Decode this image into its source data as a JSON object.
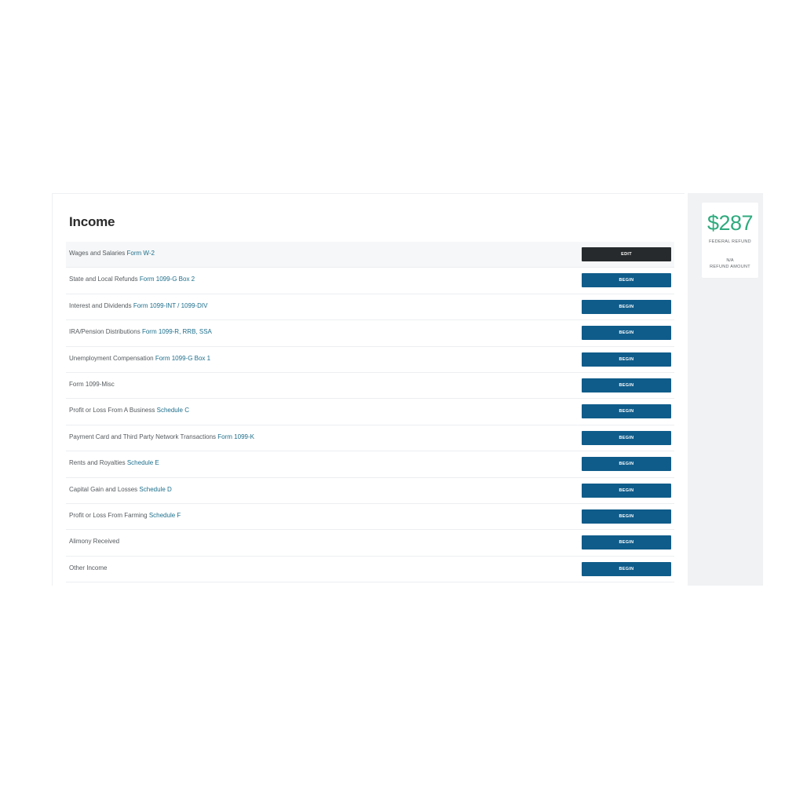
{
  "income": {
    "title": "Income",
    "rows": [
      {
        "text": "Wages and Salaries",
        "link": "Form W-2",
        "button": "EDIT"
      },
      {
        "text": "State and Local Refunds",
        "link": "Form 1099-G Box 2",
        "button": "BEGIN"
      },
      {
        "text": "Interest and Dividends",
        "link": "Form 1099-INT / 1099-DIV",
        "button": "BEGIN"
      },
      {
        "text": "IRA/Pension Distributions",
        "link": "Form 1099-R, RRB, SSA",
        "button": "BEGIN"
      },
      {
        "text": "Unemployment Compensation",
        "link": "Form 1099-G Box 1",
        "button": "BEGIN"
      },
      {
        "text": "Form 1099-Misc",
        "link": "",
        "button": "BEGIN"
      },
      {
        "text": "Profit or Loss From A Business",
        "link": "Schedule C",
        "button": "BEGIN"
      },
      {
        "text": "Payment Card and Third Party Network Transactions",
        "link": "Form 1099-K",
        "button": "BEGIN"
      },
      {
        "text": "Rents and Royalties",
        "link": "Schedule E",
        "button": "BEGIN"
      },
      {
        "text": "Capital Gain and Losses",
        "link": "Schedule D",
        "button": "BEGIN"
      },
      {
        "text": "Profit or Loss From Farming",
        "link": "Schedule F",
        "button": "BEGIN"
      },
      {
        "text": "Alimony Received",
        "link": "",
        "button": "BEGIN"
      },
      {
        "text": "Other Income",
        "link": "",
        "button": "BEGIN"
      }
    ]
  },
  "summary": {
    "federal_refund_amount": "$287",
    "federal_refund_label": "FEDERAL REFUND",
    "state_refund_value": "N/A",
    "state_refund_label": "REFUND AMOUNT"
  },
  "colors": {
    "begin_button": "#0f5c8a",
    "edit_button": "#262a2c",
    "link": "#1d6f8c",
    "refund_amount": "#2eaa7e"
  }
}
